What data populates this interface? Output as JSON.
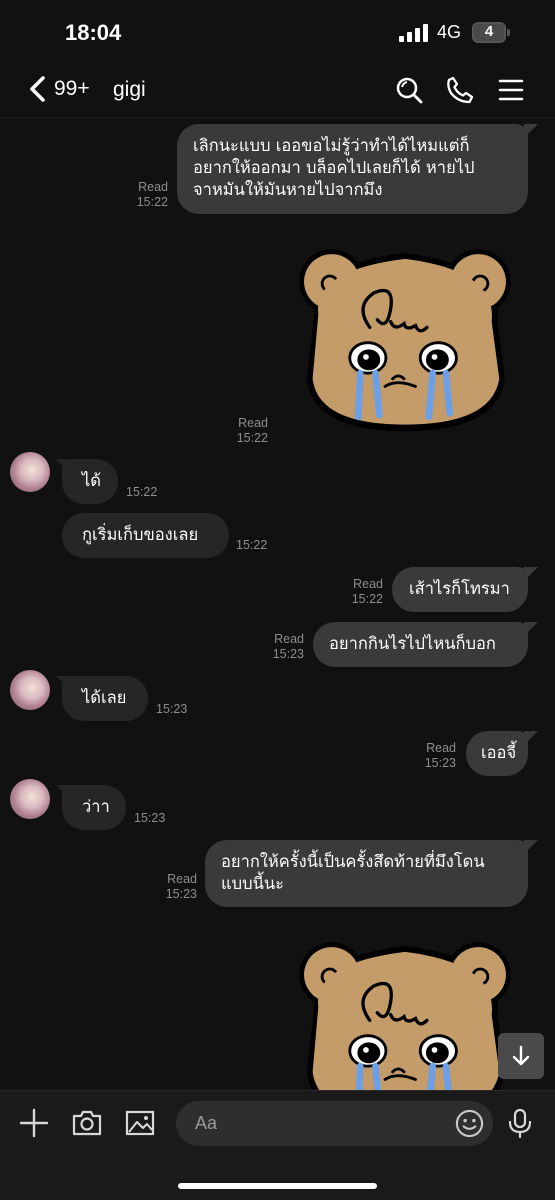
{
  "status_bar": {
    "time": "18:04",
    "network": "4G",
    "battery": "4"
  },
  "header": {
    "unread_count": "99+",
    "contact_name": "gigi",
    "icons": [
      "search-icon",
      "phone-icon",
      "menu-icon"
    ]
  },
  "messages": [
    {
      "direction": "out",
      "lines": [
        "เลิกนะแบบ เออขอไม่รู้ว่าทำได้ไหมแต่ก็",
        "อยากให้ออกมา บล็อคไปเลยก็ได้  หายไป",
        "จาหมันให้มันหายไปจากมึง"
      ],
      "read_label": "Read",
      "time": "15:22"
    },
    {
      "direction": "out",
      "type": "sticker",
      "sticker": "crying-bear-sticker",
      "read_label": "Read",
      "time": "15:22"
    },
    {
      "direction": "in",
      "text": "ได้",
      "time": "15:22"
    },
    {
      "direction": "in",
      "text": "กูเริ่มเก็บของเลย",
      "time": "15:22"
    },
    {
      "direction": "out",
      "text": "เส้าไรก็โทรมา",
      "read_label": "Read",
      "time": "15:22"
    },
    {
      "direction": "out",
      "text": "อยากกินไรไปไหนก็บอก",
      "read_label": "Read",
      "time": "15:23"
    },
    {
      "direction": "in",
      "text": "ได้เลย",
      "time": "15:23"
    },
    {
      "direction": "out",
      "text": "เออจี้",
      "read_label": "Read",
      "time": "15:23"
    },
    {
      "direction": "in",
      "text": "ว่าา",
      "time": "15:23"
    },
    {
      "direction": "out",
      "lines": [
        "อยากให้ครั้งนี้เป็นครั้งสึดท้ายที่มึงโดน",
        "แบบนี้นะ"
      ],
      "read_label": "Read",
      "time": "15:23"
    },
    {
      "direction": "out",
      "type": "sticker",
      "sticker": "crying-bear-sticker"
    }
  ],
  "input_bar": {
    "placeholder": "Aa",
    "icons": [
      "plus-icon",
      "camera-icon",
      "image-icon",
      "emoji-icon",
      "microphone-icon"
    ]
  },
  "colors": {
    "background": "#111111",
    "outgoing_bubble": "#3a3a3a",
    "incoming_bubble": "#262626",
    "meta_text": "#8d8d8d",
    "bear_fur": "#c49c6a",
    "tears": "#6b9fe8"
  }
}
